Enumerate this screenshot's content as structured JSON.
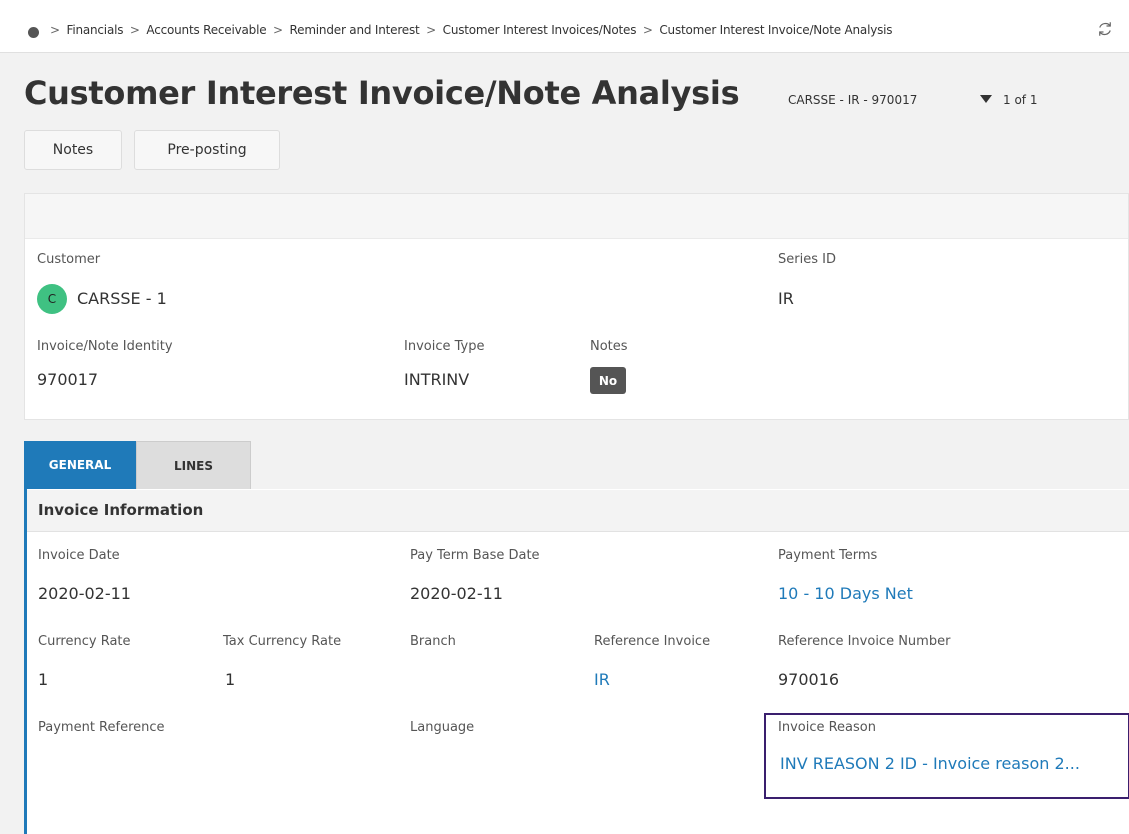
{
  "breadcrumb": [
    "Financials",
    "Accounts Receivable",
    "Reminder and Interest",
    "Customer Interest Invoices/Notes",
    "Customer Interest Invoice/Note Analysis"
  ],
  "breadcrumb_separator": ">",
  "page": {
    "title": "Customer Interest Invoice/Note Analysis",
    "record_id": "CARSSE - IR - 970017",
    "record_count": "1 of 1"
  },
  "toolbar": {
    "notes_label": "Notes",
    "preposting_label": "Pre-posting"
  },
  "header": {
    "customer_label": "Customer",
    "customer_avatar": "C",
    "customer_value": "CARSSE - 1",
    "series_id_label": "Series ID",
    "series_id_value": "IR",
    "identity_label": "Invoice/Note Identity",
    "identity_value": "970017",
    "invoice_type_label": "Invoice Type",
    "invoice_type_value": "INTRINV",
    "notes_label": "Notes",
    "notes_value": "No"
  },
  "tabs": [
    {
      "label": "GENERAL",
      "active": true
    },
    {
      "label": "LINES",
      "active": false
    }
  ],
  "invoice_info": {
    "section_title": "Invoice Information",
    "invoice_date_label": "Invoice Date",
    "invoice_date_value": "2020-02-11",
    "pay_term_base_date_label": "Pay Term Base Date",
    "pay_term_base_date_value": "2020-02-11",
    "payment_terms_label": "Payment Terms",
    "payment_terms_value": "10 - 10 Days Net",
    "currency_rate_label": "Currency Rate",
    "currency_rate_value": "1",
    "tax_currency_rate_label": "Tax Currency Rate",
    "tax_currency_rate_value": "1",
    "branch_label": "Branch",
    "reference_invoice_label": "Reference Invoice",
    "reference_invoice_value": "IR",
    "reference_invoice_number_label": "Reference Invoice Number",
    "reference_invoice_number_value": "970016",
    "payment_reference_label": "Payment Reference",
    "language_label": "Language",
    "invoice_reason_label": "Invoice Reason",
    "invoice_reason_value": "INV REASON 2 ID - Invoice reason 2..."
  },
  "colors": {
    "accent": "#1f7ab9",
    "avatar": "#3fc182",
    "focus_border": "#3a1f6e",
    "badge": "#555555"
  },
  "icons": {
    "home": "home-dot-icon",
    "refresh": "refresh-icon",
    "record_selector": "caret-down-icon"
  }
}
